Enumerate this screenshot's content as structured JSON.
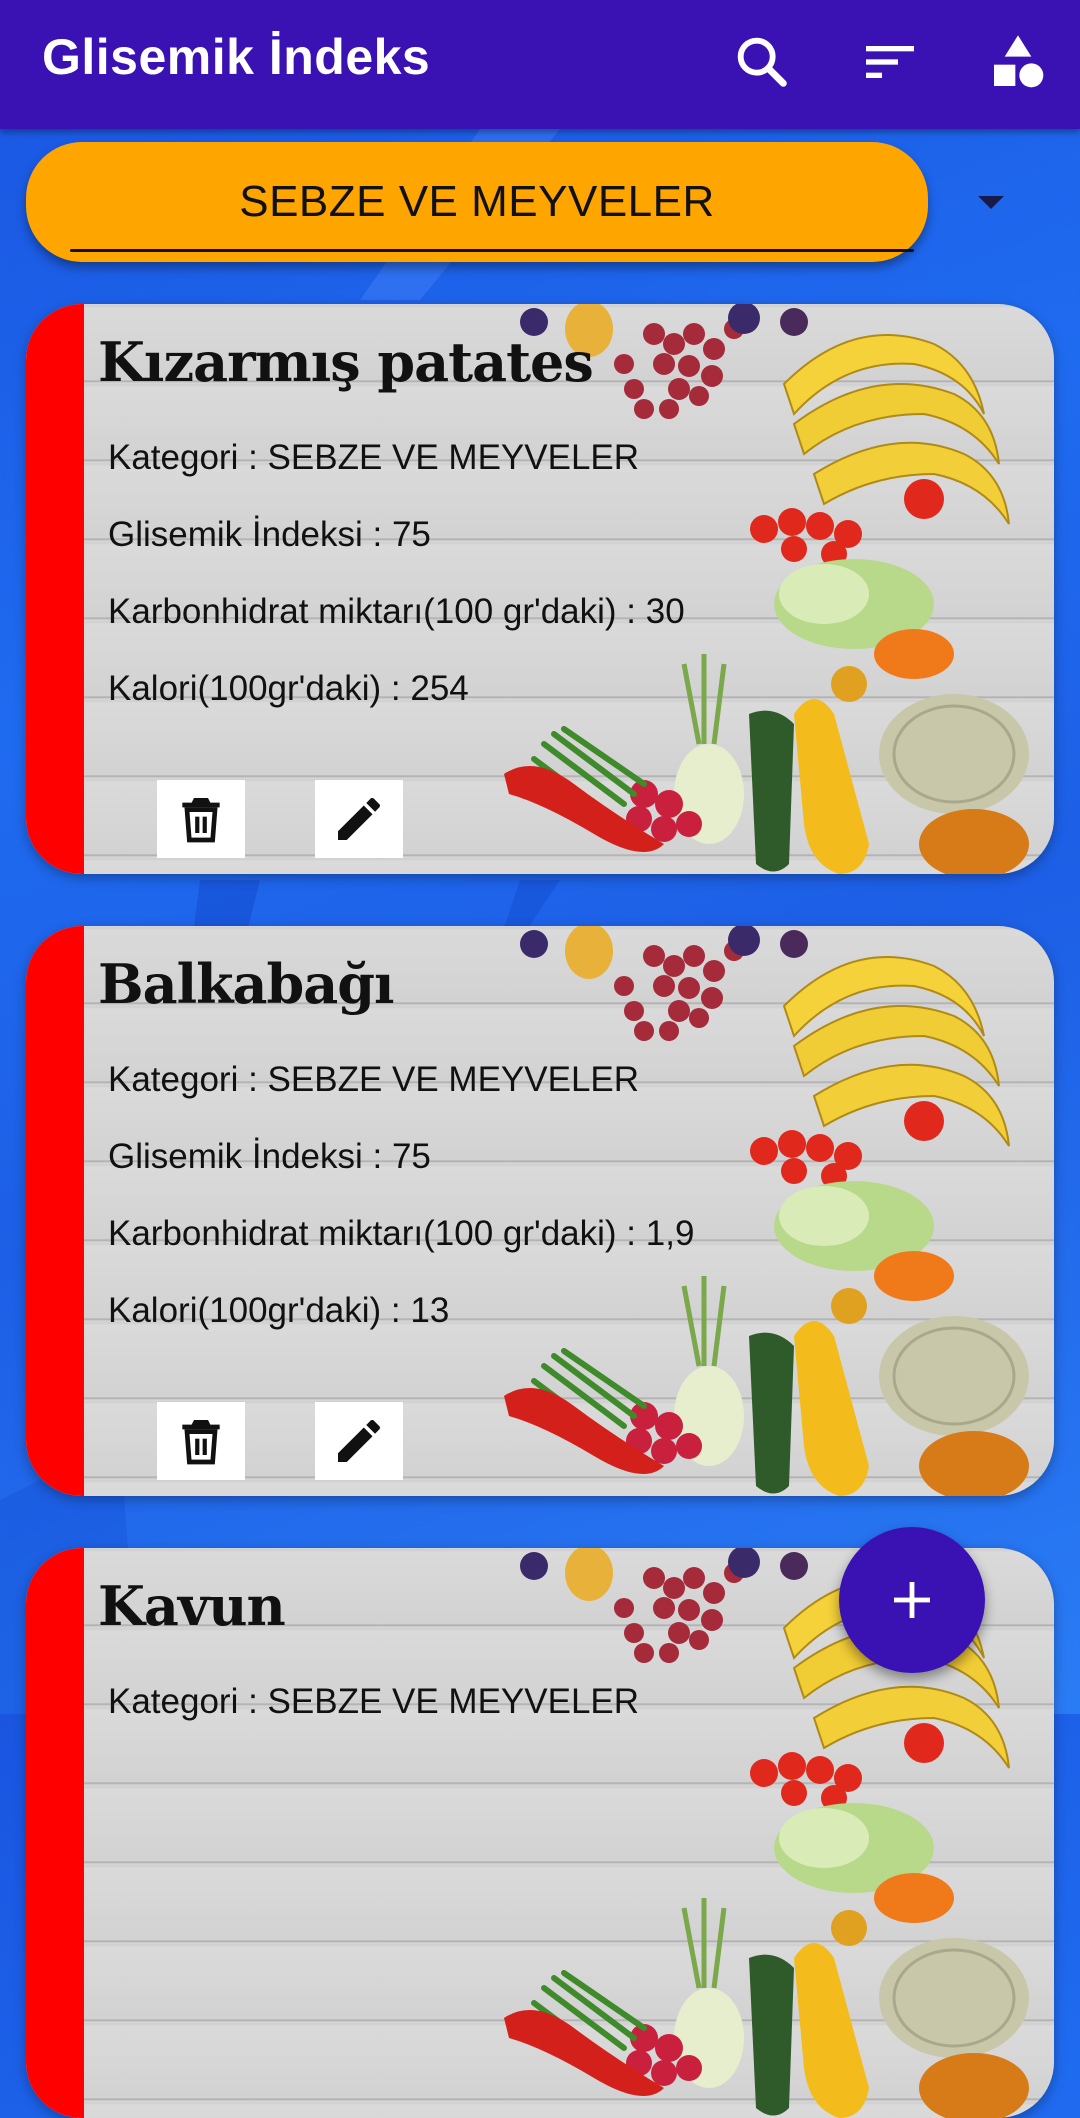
{
  "app_bar": {
    "title": "Glisemik İndeks",
    "icons": [
      "search-icon",
      "sort-icon",
      "categories-icon"
    ],
    "color": "#3a12b4"
  },
  "category_selector": {
    "selected": "SEBZE VE MEYVELER",
    "color": "#ffa500"
  },
  "cards": [
    {
      "name": "Kızarmış patates",
      "category_label": "Kategori : SEBZE VE MEYVELER",
      "gi_label": "Glisemik İndeksi : 75",
      "carb_label": "Karbonhidrat miktarı(100 gr'daki) : 30",
      "kcal_label": "Kalori(100gr'daki) : 254",
      "accent": "#ff0000"
    },
    {
      "name": "Balkabağı",
      "category_label": "Kategori : SEBZE VE MEYVELER",
      "gi_label": "Glisemik İndeksi : 75",
      "carb_label": "Karbonhidrat miktarı(100 gr'daki) : 1,9",
      "kcal_label": "Kalori(100gr'daki) : 13",
      "accent": "#ff0000"
    },
    {
      "name": "Kavun",
      "category_label": "Kategori : SEBZE VE MEYVELER",
      "accent": "#ff0000"
    }
  ],
  "fab": {
    "icon": "plus-icon",
    "color": "#3a12b4"
  }
}
